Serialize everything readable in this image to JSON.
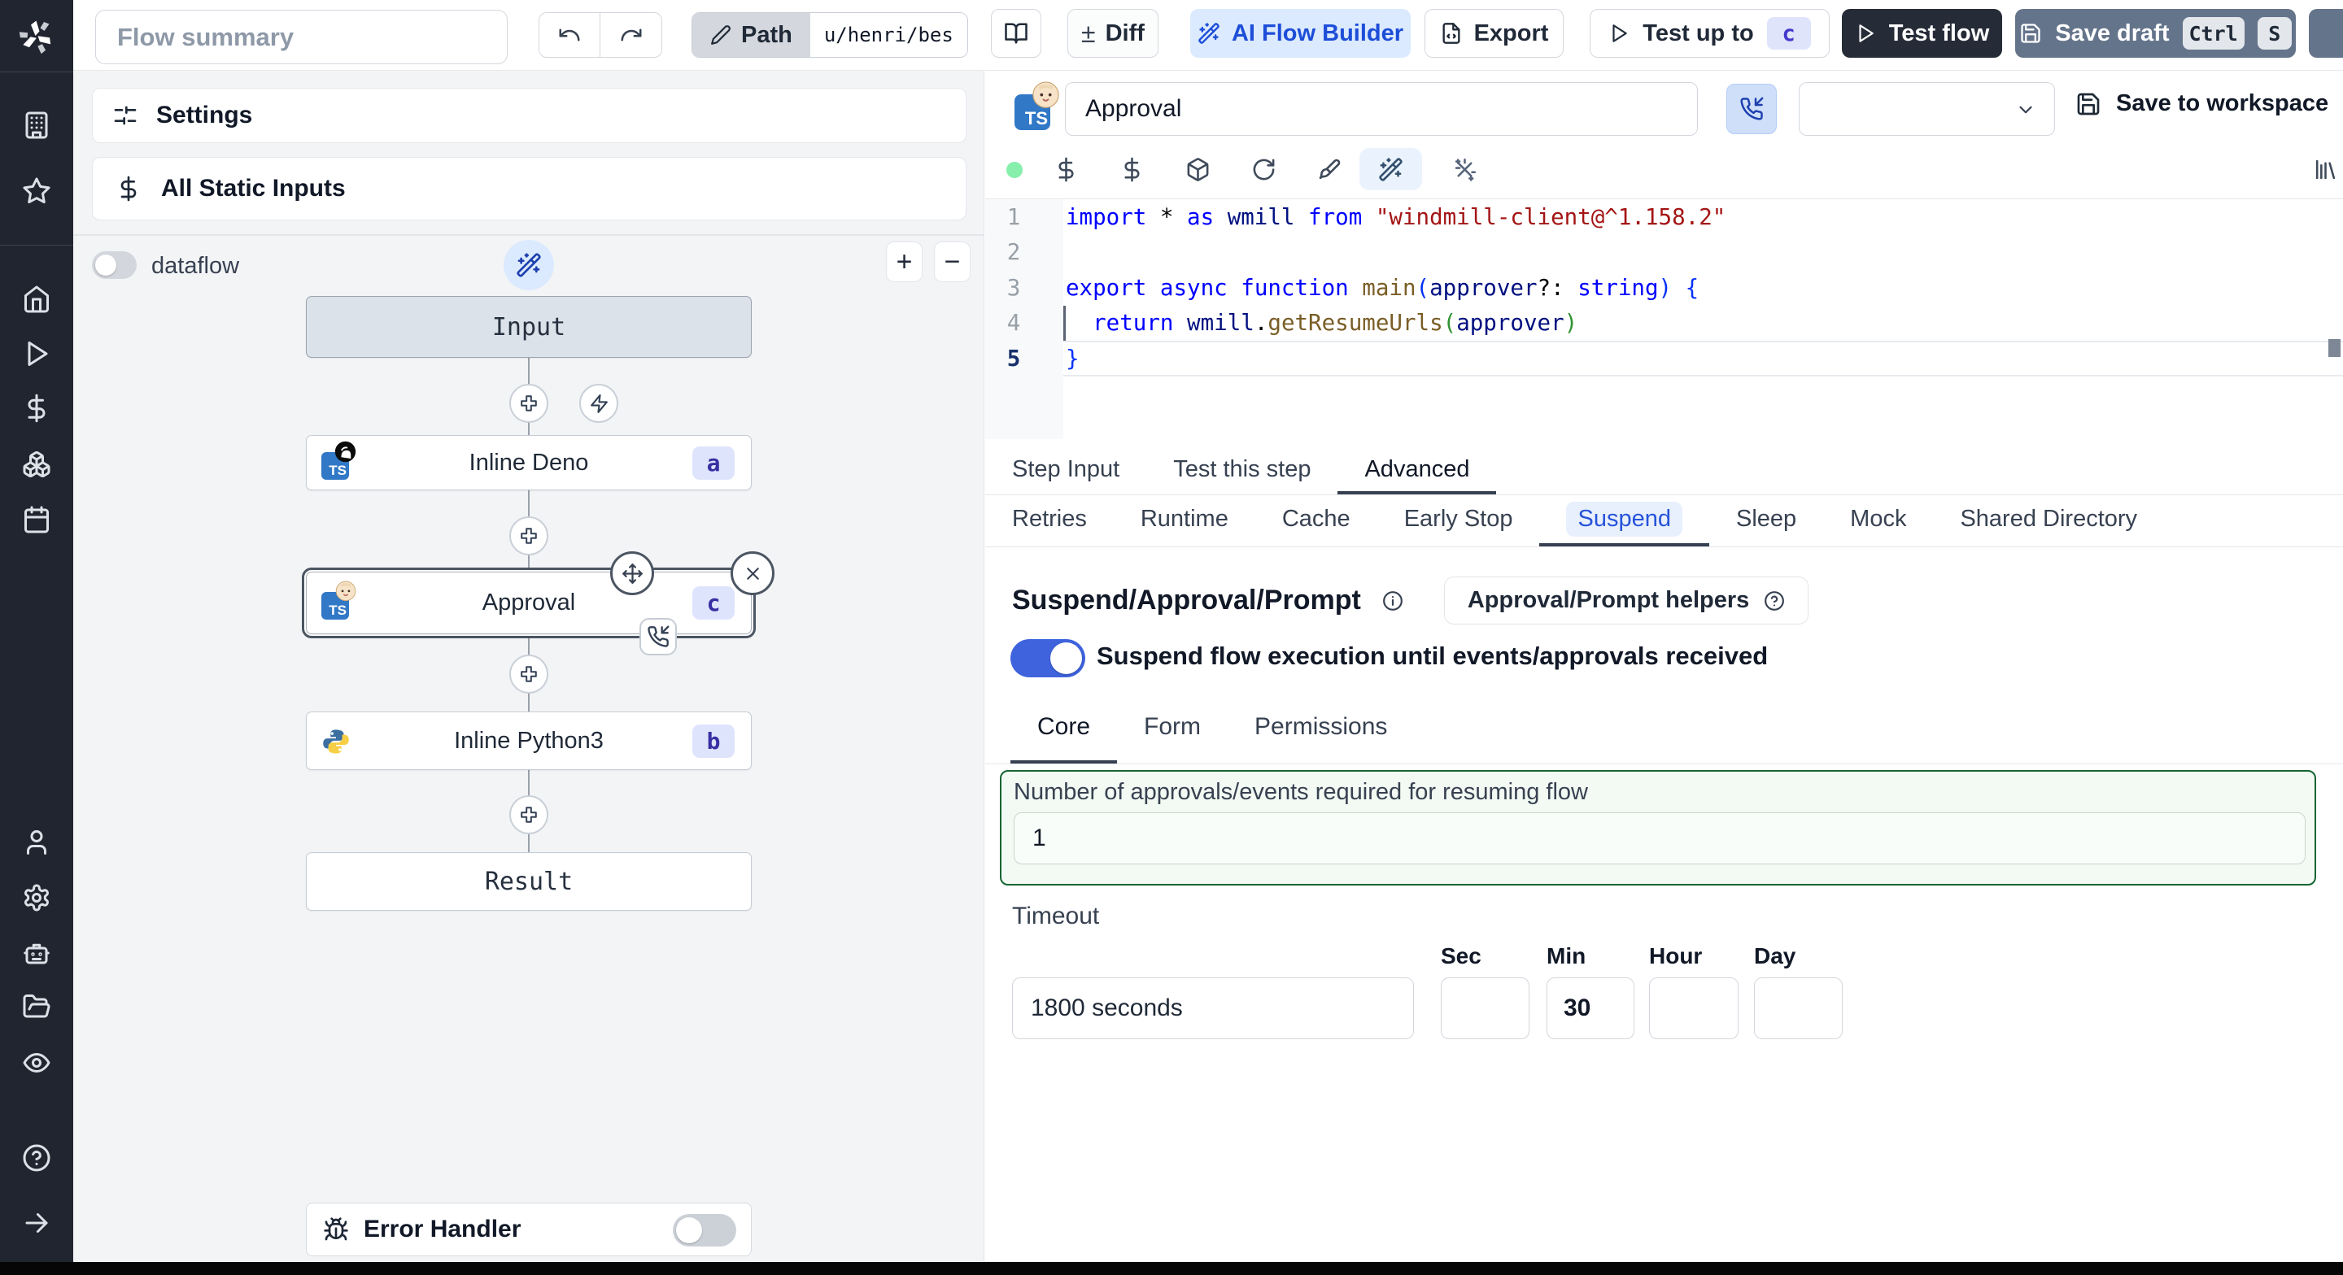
{
  "app": {
    "name": "Windmill Flow Editor"
  },
  "colors": {
    "sidebar_bg": "#212530",
    "accent_blue": "#2653d9",
    "toggle_on": "#3e63dd",
    "ts_blue": "#3178c6",
    "ai_btn_bg": "#dbeafe",
    "ai_btn_text": "#1d4ed8",
    "save_draft_bg": "#64748b",
    "test_flow_bg": "#252b37",
    "badge_bg": "#dee4fc",
    "badge_text": "#3730a3",
    "green_border": "#166534",
    "green_bg": "#f2faf3",
    "status_dot": "#86efac"
  },
  "sidebar": {
    "icons": [
      "windmill-logo",
      "building",
      "star",
      "home",
      "play",
      "dollar",
      "boxes",
      "calendar",
      "user",
      "gear",
      "robot",
      "folder-open",
      "eye",
      "help-circle",
      "arrow-right"
    ]
  },
  "topbar": {
    "summary_placeholder": "Flow summary",
    "path_label": "Path",
    "path_value": "u/henri/bes",
    "diff_glyph": "±",
    "diff_label": "Diff",
    "ai_flow_builder_label": "AI Flow Builder",
    "export_label": "Export",
    "test_up_to_label": "Test up to",
    "test_up_to_step": "c",
    "test_flow_label": "Test flow",
    "save_draft_label": "Save draft",
    "shortcut_ctrl": "Ctrl",
    "shortcut_s": "S"
  },
  "left_panel": {
    "settings_label": "Settings",
    "static_inputs_label": "All Static Inputs",
    "dataflow_label": "dataflow",
    "zoom_in_glyph": "+",
    "zoom_out_glyph": "−",
    "error_handler_label": "Error Handler"
  },
  "flow": {
    "nodes": {
      "input": {
        "label": "Input"
      },
      "a": {
        "label": "Inline Deno",
        "badge": "a",
        "lang": "deno-typescript"
      },
      "c": {
        "label": "Approval",
        "badge": "c",
        "lang": "deno-typescript",
        "selected": true,
        "suspend": true
      },
      "b": {
        "label": "Inline Python3",
        "badge": "b",
        "lang": "python3"
      },
      "result": {
        "label": "Result"
      }
    }
  },
  "module_editor": {
    "language_badge": "TS",
    "name_value": "Approval",
    "picker_value": "",
    "save_to_workspace_label": "Save to workspace"
  },
  "editor": {
    "lines": [
      {
        "n": "1",
        "tokens": [
          {
            "c": "kw",
            "t": "import"
          },
          {
            "c": "pl",
            "t": " * "
          },
          {
            "c": "kw",
            "t": "as"
          },
          {
            "c": "id",
            "t": " wmill "
          },
          {
            "c": "kw",
            "t": "from"
          },
          {
            "c": "str",
            "t": " \"windmill-client@^1.158.2\""
          }
        ]
      },
      {
        "n": "2",
        "tokens": []
      },
      {
        "n": "3",
        "tokens": [
          {
            "c": "kw",
            "t": "export"
          },
          {
            "c": "pl",
            "t": " "
          },
          {
            "c": "kw",
            "t": "async"
          },
          {
            "c": "pl",
            "t": " "
          },
          {
            "c": "kw",
            "t": "function"
          },
          {
            "c": "pl",
            "t": " "
          },
          {
            "c": "fn",
            "t": "main"
          },
          {
            "c": "br0",
            "t": "("
          },
          {
            "c": "id",
            "t": "approver"
          },
          {
            "c": "pl",
            "t": "?: "
          },
          {
            "c": "kw",
            "t": "string"
          },
          {
            "c": "br0",
            "t": ")"
          },
          {
            "c": "pl",
            "t": " "
          },
          {
            "c": "br0",
            "t": "{"
          }
        ]
      },
      {
        "n": "4",
        "tokens": [
          {
            "c": "pl",
            "t": "  "
          },
          {
            "c": "kw",
            "t": "return"
          },
          {
            "c": "pl",
            "t": " "
          },
          {
            "c": "id",
            "t": "wmill"
          },
          {
            "c": "pl",
            "t": "."
          },
          {
            "c": "fn",
            "t": "getResumeUrls"
          },
          {
            "c": "br1",
            "t": "("
          },
          {
            "c": "id",
            "t": "approver"
          },
          {
            "c": "br1",
            "t": ")"
          }
        ]
      },
      {
        "n": "5",
        "tokens": [
          {
            "c": "br0",
            "t": "}"
          }
        ]
      }
    ]
  },
  "tabs": {
    "main": {
      "items": [
        "Step Input",
        "Test this step",
        "Advanced"
      ],
      "active": "Advanced"
    },
    "advanced": {
      "items": [
        "Retries",
        "Runtime",
        "Cache",
        "Early Stop",
        "Suspend",
        "Sleep",
        "Mock",
        "Shared Directory"
      ],
      "active": "Suspend"
    }
  },
  "suspend_section": {
    "heading": "Suspend/Approval/Prompt",
    "helpers_button_label": "Approval/Prompt helpers",
    "toggle_label": "Suspend flow execution until events/approvals received",
    "toggle_on": true,
    "subtabs": {
      "items": [
        "Core",
        "Form",
        "Permissions"
      ],
      "active": "Core"
    },
    "approvals_label": "Number of approvals/events required for resuming flow",
    "approvals_value": "1",
    "timeout_label": "Timeout",
    "timeout_value": "1800 seconds",
    "units": [
      {
        "label": "Sec",
        "value": ""
      },
      {
        "label": "Min",
        "value": "30"
      },
      {
        "label": "Hour",
        "value": ""
      },
      {
        "label": "Day",
        "value": ""
      }
    ]
  }
}
